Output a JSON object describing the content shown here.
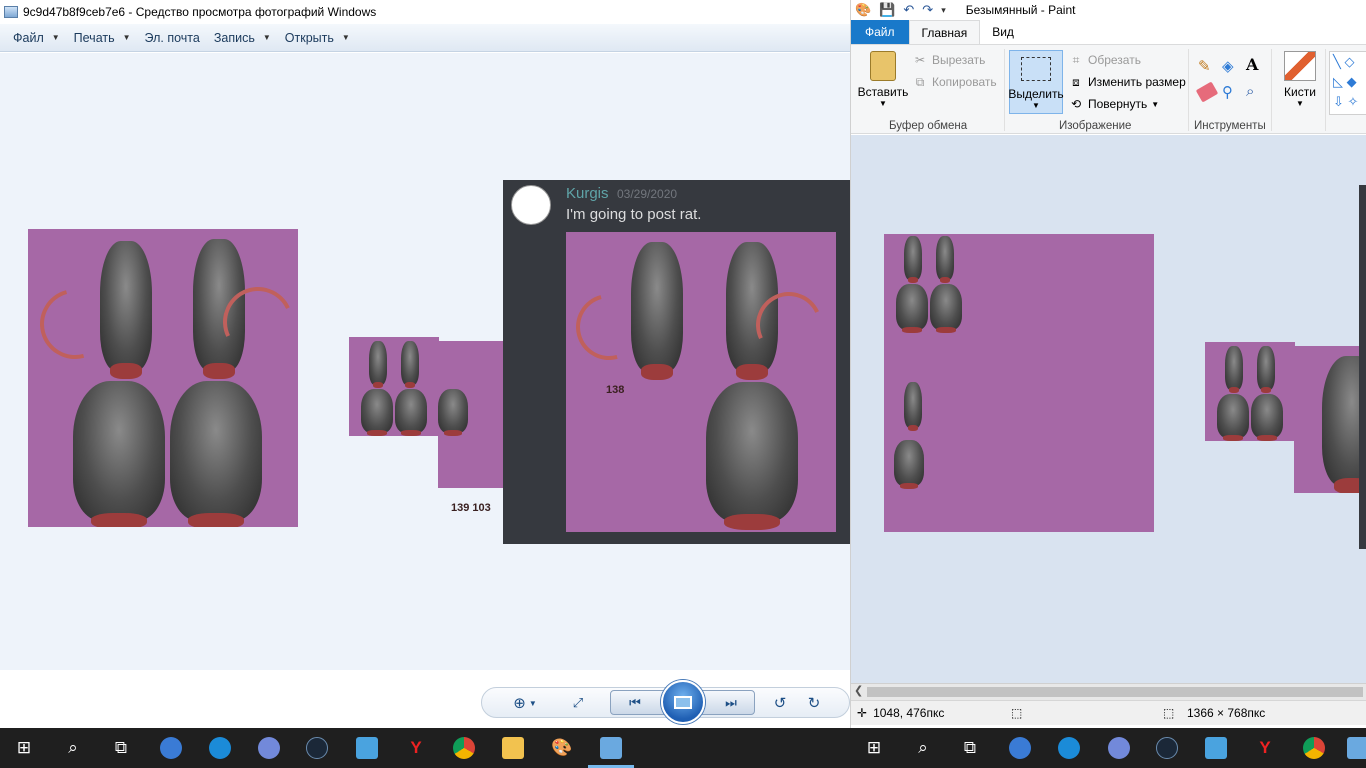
{
  "viewer": {
    "title": "9c9d47b8f9ceb7e6 - Средство просмотра фотографий Windows",
    "menu": [
      {
        "label": "Файл",
        "has_caret": true
      },
      {
        "label": "Печать",
        "has_caret": true
      },
      {
        "label": "Эл. почта",
        "has_caret": false
      },
      {
        "label": "Запись",
        "has_caret": true
      },
      {
        "label": "Открыть",
        "has_caret": true
      }
    ],
    "captions": {
      "small_sheet": "139 103",
      "discord_sheet": "138"
    },
    "discord": {
      "username": "Kurgis",
      "date": "03/29/2020",
      "message": "I'm going to post rat."
    },
    "controls": {
      "zoom_icon": "zoom-icon",
      "fit_icon": "actual-size-icon",
      "prev_icon": "previous-icon",
      "slideshow_icon": "slideshow-icon",
      "next_icon": "next-icon",
      "rotate_left_icon": "rotate-ccw-icon",
      "rotate_right_icon": "rotate-cw-icon"
    }
  },
  "paint": {
    "title": "Безымянный - Paint",
    "tabs": {
      "file": "Файл",
      "home": "Главная",
      "view": "Вид"
    },
    "clipboard": {
      "paste": "Вставить",
      "cut": "Вырезать",
      "copy": "Копировать",
      "group": "Буфер обмена"
    },
    "image": {
      "select": "Выделить",
      "crop": "Обрезать",
      "resize": "Изменить размер",
      "rotate": "Повернуть",
      "group": "Изображение"
    },
    "tools": {
      "group": "Инструменты",
      "brushes": "Кисти"
    },
    "status": {
      "position": "1048, 476пкс",
      "size": "1366 × 768пкс"
    }
  },
  "colors": {
    "sprite_bg": "#a668a6",
    "discord_bg": "#36393f",
    "paint_accent": "#1979ca",
    "taskbar": "#1f1f1f"
  },
  "taskbar_left": [
    "windows-icon",
    "search-icon",
    "task-view-icon",
    "app-icon-1",
    "app-icon-2",
    "discord-icon",
    "steam-icon",
    "app-icon-3",
    "yandex-icon",
    "chrome-icon",
    "folder-icon",
    "paint-icon",
    "photo-viewer-icon"
  ],
  "taskbar_right": [
    "windows-icon",
    "search-icon",
    "task-view-icon",
    "app-icon-1",
    "app-icon-2",
    "discord-icon",
    "steam-icon",
    "app-icon-3",
    "yandex-icon",
    "chrome-icon",
    "photo-viewer-icon"
  ]
}
